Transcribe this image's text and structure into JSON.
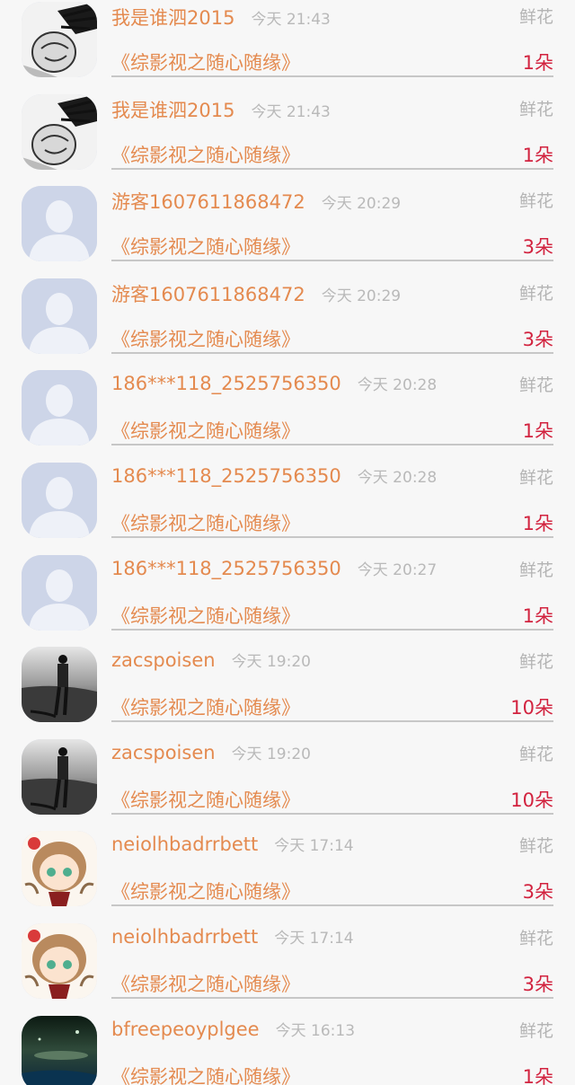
{
  "colors": {
    "name": "#e48a4f",
    "time": "#b9b9b9",
    "count": "#d2233f",
    "divider": "#c7c7c7"
  },
  "rows": [
    {
      "avatar": "manga-avatar",
      "name": "我是谁泗2015",
      "time": "今天 21:43",
      "gift": "鲜花",
      "book": "《综影视之随心随缘》",
      "count": "1朵"
    },
    {
      "avatar": "manga-avatar",
      "name": "我是谁泗2015",
      "time": "今天 21:43",
      "gift": "鲜花",
      "book": "《综影视之随心随缘》",
      "count": "1朵"
    },
    {
      "avatar": "default-avatar",
      "name": "游客1607611868472",
      "time": "今天 20:29",
      "gift": "鲜花",
      "book": "《综影视之随心随缘》",
      "count": "3朵"
    },
    {
      "avatar": "default-avatar",
      "name": "游客1607611868472",
      "time": "今天 20:29",
      "gift": "鲜花",
      "book": "《综影视之随心随缘》",
      "count": "3朵"
    },
    {
      "avatar": "default-avatar",
      "name": "186***118_2525756350",
      "time": "今天 20:28",
      "gift": "鲜花",
      "book": "《综影视之随心随缘》",
      "count": "1朵"
    },
    {
      "avatar": "default-avatar",
      "name": "186***118_2525756350",
      "time": "今天 20:28",
      "gift": "鲜花",
      "book": "《综影视之随心随缘》",
      "count": "1朵"
    },
    {
      "avatar": "default-avatar",
      "name": "186***118_2525756350",
      "time": "今天 20:27",
      "gift": "鲜花",
      "book": "《综影视之随心随缘》",
      "count": "1朵"
    },
    {
      "avatar": "photo-man-avatar",
      "name": "zacspoisen",
      "time": "今天 19:20",
      "gift": "鲜花",
      "book": "《综影视之随心随缘》",
      "count": "10朵"
    },
    {
      "avatar": "photo-man-avatar",
      "name": "zacspoisen",
      "time": "今天 19:20",
      "gift": "鲜花",
      "book": "《综影视之随心随缘》",
      "count": "10朵"
    },
    {
      "avatar": "anime-girl-avatar",
      "name": "neiolhbadrrbett",
      "time": "今天 17:14",
      "gift": "鲜花",
      "book": "《综影视之随心随缘》",
      "count": "3朵"
    },
    {
      "avatar": "anime-girl-avatar",
      "name": "neiolhbadrrbett",
      "time": "今天 17:14",
      "gift": "鲜花",
      "book": "《综影视之随心随缘》",
      "count": "3朵"
    },
    {
      "avatar": "night-sky-avatar",
      "name": "bfreepeoyplgee",
      "time": "今天 16:13",
      "gift": "鲜花",
      "book": "《综影视之随心随缘》",
      "count": "1朵"
    }
  ]
}
